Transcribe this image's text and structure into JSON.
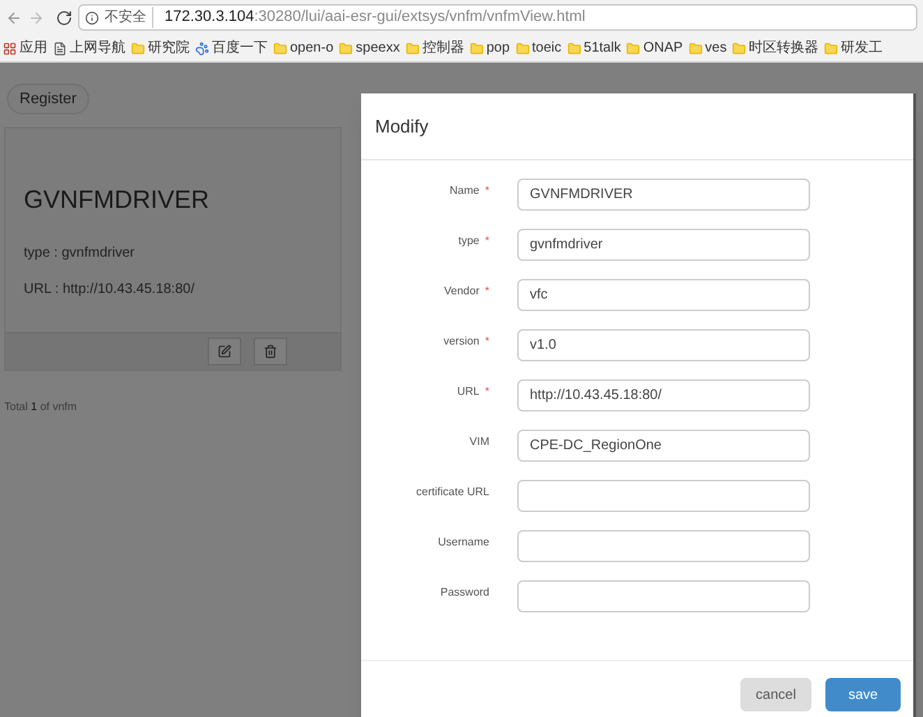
{
  "browser": {
    "security_label": "不安全",
    "url_host": "172.30.3.104",
    "url_rest": ":30280/lui/aai-esr-gui/extsys/vnfm/vnfmView.html",
    "bookmarks": [
      {
        "label": "应用",
        "kind": "apps"
      },
      {
        "label": "上网导航",
        "kind": "page"
      },
      {
        "label": "研究院",
        "kind": "folder"
      },
      {
        "label": "百度一下",
        "kind": "paw"
      },
      {
        "label": "open-o",
        "kind": "folder"
      },
      {
        "label": "speexx",
        "kind": "folder"
      },
      {
        "label": "控制器",
        "kind": "folder"
      },
      {
        "label": "pop",
        "kind": "folder"
      },
      {
        "label": "toeic",
        "kind": "folder"
      },
      {
        "label": "51talk",
        "kind": "folder"
      },
      {
        "label": "ONAP",
        "kind": "folder"
      },
      {
        "label": "ves",
        "kind": "folder"
      },
      {
        "label": "时区转换器",
        "kind": "folder"
      },
      {
        "label": "研发工",
        "kind": "folder"
      }
    ]
  },
  "page": {
    "register_button": "Register",
    "card": {
      "title": "GVNFMDRIVER",
      "lines": [
        "type : gvnfmdriver",
        "URL : http://10.43.45.18:80/"
      ]
    },
    "total": {
      "before": "Total",
      "count": "1",
      "after": "of vnfm"
    }
  },
  "modal": {
    "title": "Modify",
    "required_marker": "*",
    "fields": [
      {
        "label": "Name",
        "required": true,
        "value": "GVNFMDRIVER"
      },
      {
        "label": "type",
        "required": true,
        "value": "gvnfmdriver"
      },
      {
        "label": "Vendor",
        "required": true,
        "value": "vfc"
      },
      {
        "label": "version",
        "required": true,
        "value": "v1.0"
      },
      {
        "label": "URL",
        "required": true,
        "value": "http://10.43.45.18:80/"
      },
      {
        "label": "VIM",
        "required": false,
        "value": "CPE-DC_RegionOne"
      },
      {
        "label": "certificate URL",
        "required": false
      },
      {
        "label": "Username",
        "required": false
      },
      {
        "label": "Password",
        "required": false
      }
    ],
    "buttons": [
      {
        "label": "cancel",
        "primary": false
      },
      {
        "label": "save",
        "primary": true
      }
    ]
  }
}
